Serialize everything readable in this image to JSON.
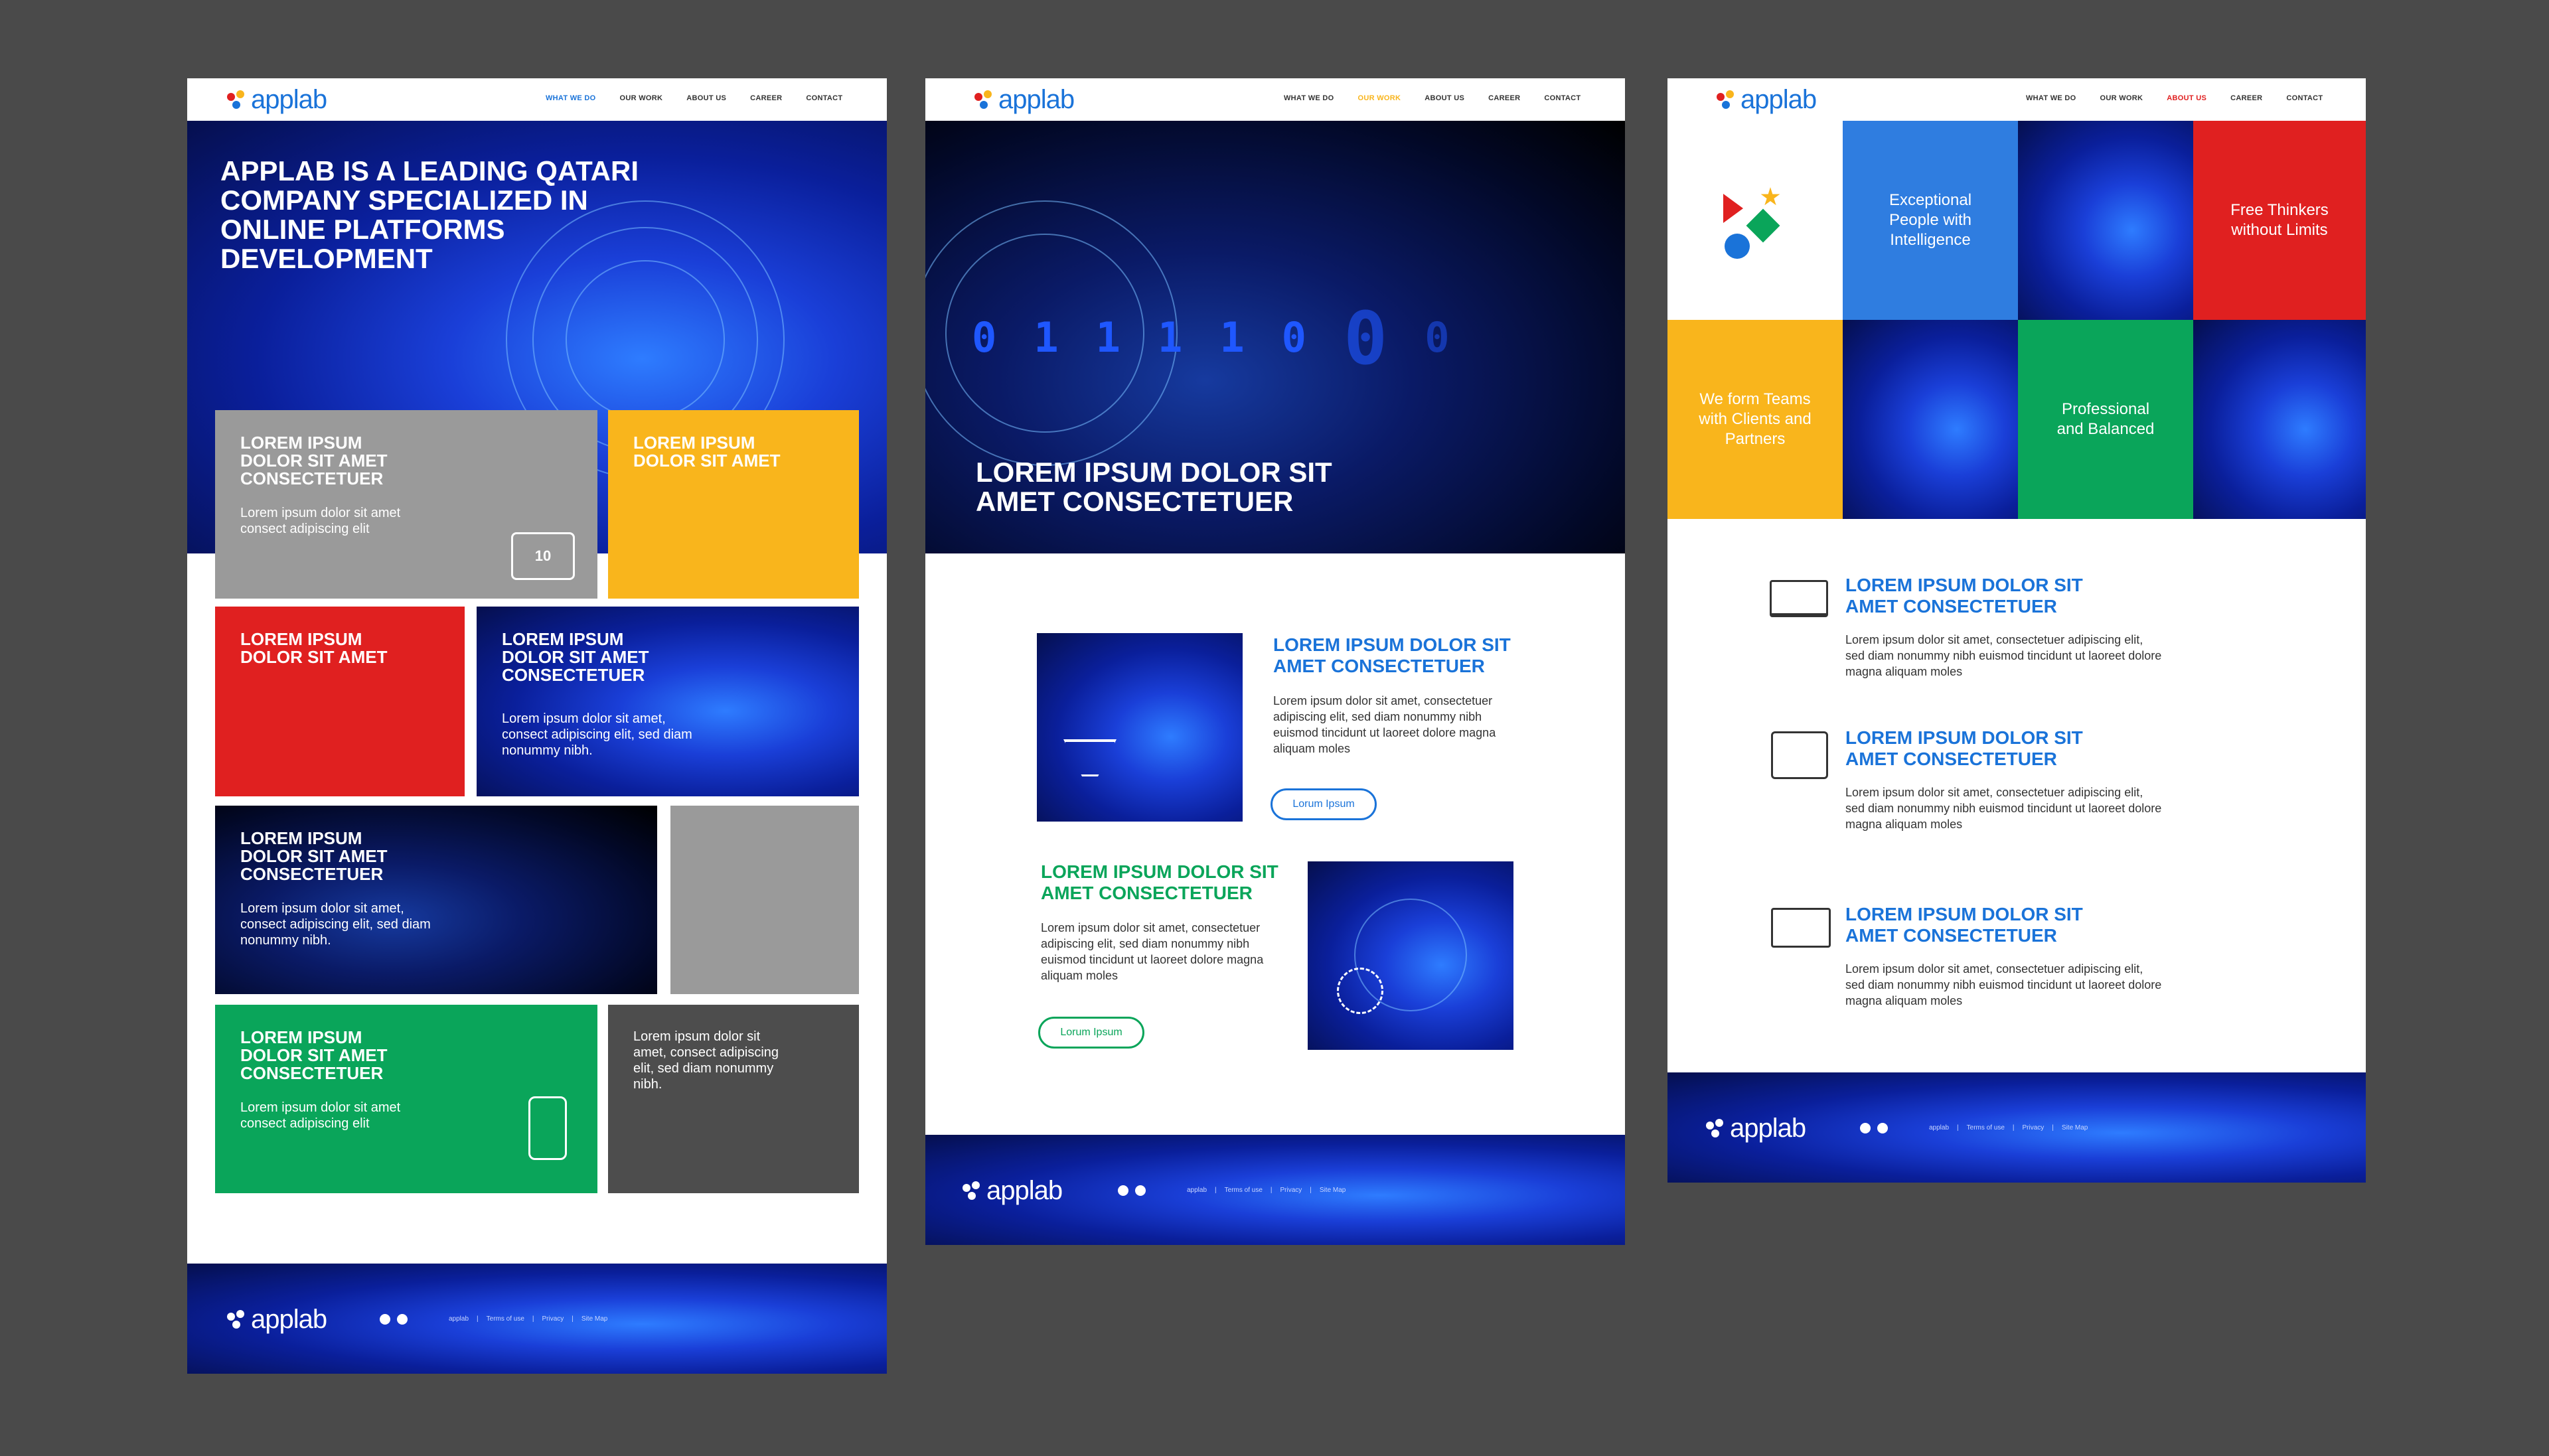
{
  "brand": "applab",
  "colors": {
    "blue": "#1a73d9",
    "green": "#0aa55a",
    "red": "#e02020",
    "yellow": "#f9b51c",
    "grey": "#9a9a9a",
    "darkgrey": "#4d4d4d"
  },
  "nav": [
    "WHAT WE DO",
    "OUR WORK",
    "ABOUT US",
    "CAREER",
    "CONTACT"
  ],
  "footer_links": [
    "applab",
    "Terms of use",
    "Privacy",
    "Site Map"
  ],
  "page1": {
    "active_nav": "WHAT WE DO",
    "hero_title": "APPLAB IS A LEADING QATARI COMPANY SPECIALIZED IN ONLINE PLATFORMS DEVELOPMENT",
    "tiles": [
      {
        "title": "LOREM IPSUM DOLOR SIT AMET CONSECTETUER",
        "text": "Lorem ipsum dolor sit amet consect adipiscing elit",
        "icon": "binary-code-icon"
      },
      {
        "title": "LOREM IPSUM DOLOR SIT AMET"
      },
      {
        "title": "LOREM IPSUM DOLOR SIT AMET"
      },
      {
        "title": "LOREM IPSUM DOLOR SIT AMET CONSECTETUER",
        "text": "Lorem ipsum dolor sit amet, consect adipiscing elit, sed diam nonummy nibh."
      },
      {
        "title": "LOREM IPSUM DOLOR SIT AMET CONSECTETUER",
        "text": "Lorem ipsum dolor sit amet, consect adipiscing elit, sed diam nonummy nibh."
      },
      {
        "title": "LOREM IPSUM DOLOR SIT AMET CONSECTETUER",
        "text": "Lorem ipsum dolor sit amet consect adipiscing elit",
        "icon": "mobile-settings-icon"
      },
      {
        "text": "Lorem ipsum dolor sit amet, consect adipiscing elit, sed diam nonummy nibh."
      }
    ]
  },
  "page2": {
    "active_nav": "OUR WORK",
    "binary": [
      "0",
      "1",
      "1",
      "1",
      "1",
      "0",
      "0",
      "0"
    ],
    "hero_title": "LOREM IPSUM DOLOR SIT AMET CONSECTETUER",
    "sections": [
      {
        "title": "LOREM IPSUM DOLOR SIT AMET CONSECTETUER",
        "text": "Lorem ipsum dolor sit amet, consectetuer adipiscing elit, sed diam nonummy nibh euismod tincidunt ut laoreet dolore magna aliquam moles",
        "button": "Lorum Ipsum",
        "icon": "filter-funnel-icon"
      },
      {
        "title": "LOREM IPSUM DOLOR SIT AMET CONSECTETUER",
        "text": "Lorem ipsum dolor sit amet, consectetuer adipiscing elit, sed diam nonummy nibh euismod tincidunt ut laoreet dolore magna aliquam moles",
        "button": "Lorum Ipsum",
        "icon": "process-gear-icon"
      }
    ]
  },
  "page3": {
    "active_nav": "ABOUT US",
    "values": [
      "Exceptional People with Intelligence",
      "Free Thinkers without Limits",
      "We form Teams with Clients and Partners",
      "Professional and Balanced"
    ],
    "features": [
      {
        "title": "LOREM IPSUM DOLOR SIT AMET CONSECTETUER",
        "text": "Lorem ipsum dolor sit amet, consectetuer adipiscing elit, sed diam nonummy nibh euismod tincidunt ut laoreet dolore magna aliquam moles",
        "icon": "laptop-settings-icon"
      },
      {
        "title": "LOREM IPSUM DOLOR SIT AMET CONSECTETUER",
        "text": "Lorem ipsum dolor sit amet, consectetuer adipiscing elit, sed diam nonummy nibh euismod tincidunt ut laoreet dolore magna aliquam moles",
        "icon": "device-sync-icon"
      },
      {
        "title": "LOREM IPSUM DOLOR SIT AMET CONSECTETUER",
        "text": "Lorem ipsum dolor sit amet, consectetuer adipiscing elit, sed diam nonummy nibh euismod tincidunt ut laoreet dolore magna aliquam moles",
        "icon": "analytics-monitor-icon"
      }
    ]
  }
}
